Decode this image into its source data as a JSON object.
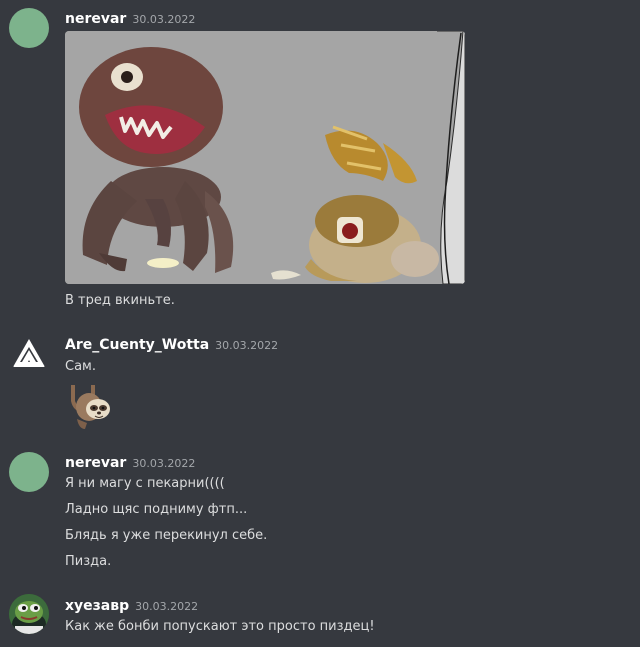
{
  "messages": [
    {
      "username": "nerevar",
      "timestamp": "30.03.2022",
      "avatar": "green-circle-avatar",
      "attachment": "meme-image",
      "lines": [
        "В тред вкиньте."
      ]
    },
    {
      "username": "Are_Cuenty_Wotta",
      "timestamp": "30.03.2022",
      "avatar": "white-triangle-logo",
      "lines": [
        "Сам."
      ],
      "sticker": "sloth-emoji"
    },
    {
      "username": "nerevar",
      "timestamp": "30.03.2022",
      "avatar": "green-circle-avatar",
      "lines": [
        "Я ни магу с пекарни((((",
        "Ладно щяс подниму фтп...",
        "Блядь я уже перекинул себе.",
        "Пизда."
      ]
    },
    {
      "username": "хуезавр",
      "timestamp": "30.03.2022",
      "avatar": "frog-avatar",
      "lines": [
        "Как же бонби попускают это просто пиздец!"
      ]
    }
  ],
  "colors": {
    "background": "#36393f",
    "username": "#ffffff",
    "timestamp": "#a3a6aa",
    "text": "#dcddde",
    "avatar_green": "#7db38c"
  }
}
